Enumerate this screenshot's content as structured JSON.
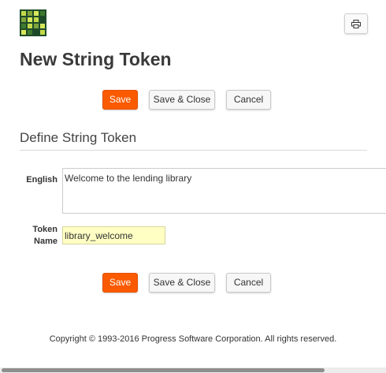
{
  "logo": {
    "name": "logo-icon",
    "colors": [
      "#1f4a2a",
      "#c4d94a",
      "#7fa33a",
      "#3f7a2e",
      "#d6e65a"
    ]
  },
  "toolbar": {
    "print_icon": "printer-icon"
  },
  "page_title": "New String Token",
  "buttons": {
    "save": "Save",
    "save_close": "Save & Close",
    "cancel": "Cancel"
  },
  "section_title": "Define String Token",
  "form": {
    "english": {
      "label": "English",
      "value": "Welcome to the lending library"
    },
    "token_name": {
      "label_line1": "Token",
      "label_line2": "Name",
      "value": "library_welcome"
    }
  },
  "footer": {
    "copyright": "Copyright © 1993-2016 Progress Software Corporation. All rights reserved."
  },
  "colors": {
    "accent": "#fa5a00",
    "highlight_field": "#ffffc4"
  }
}
